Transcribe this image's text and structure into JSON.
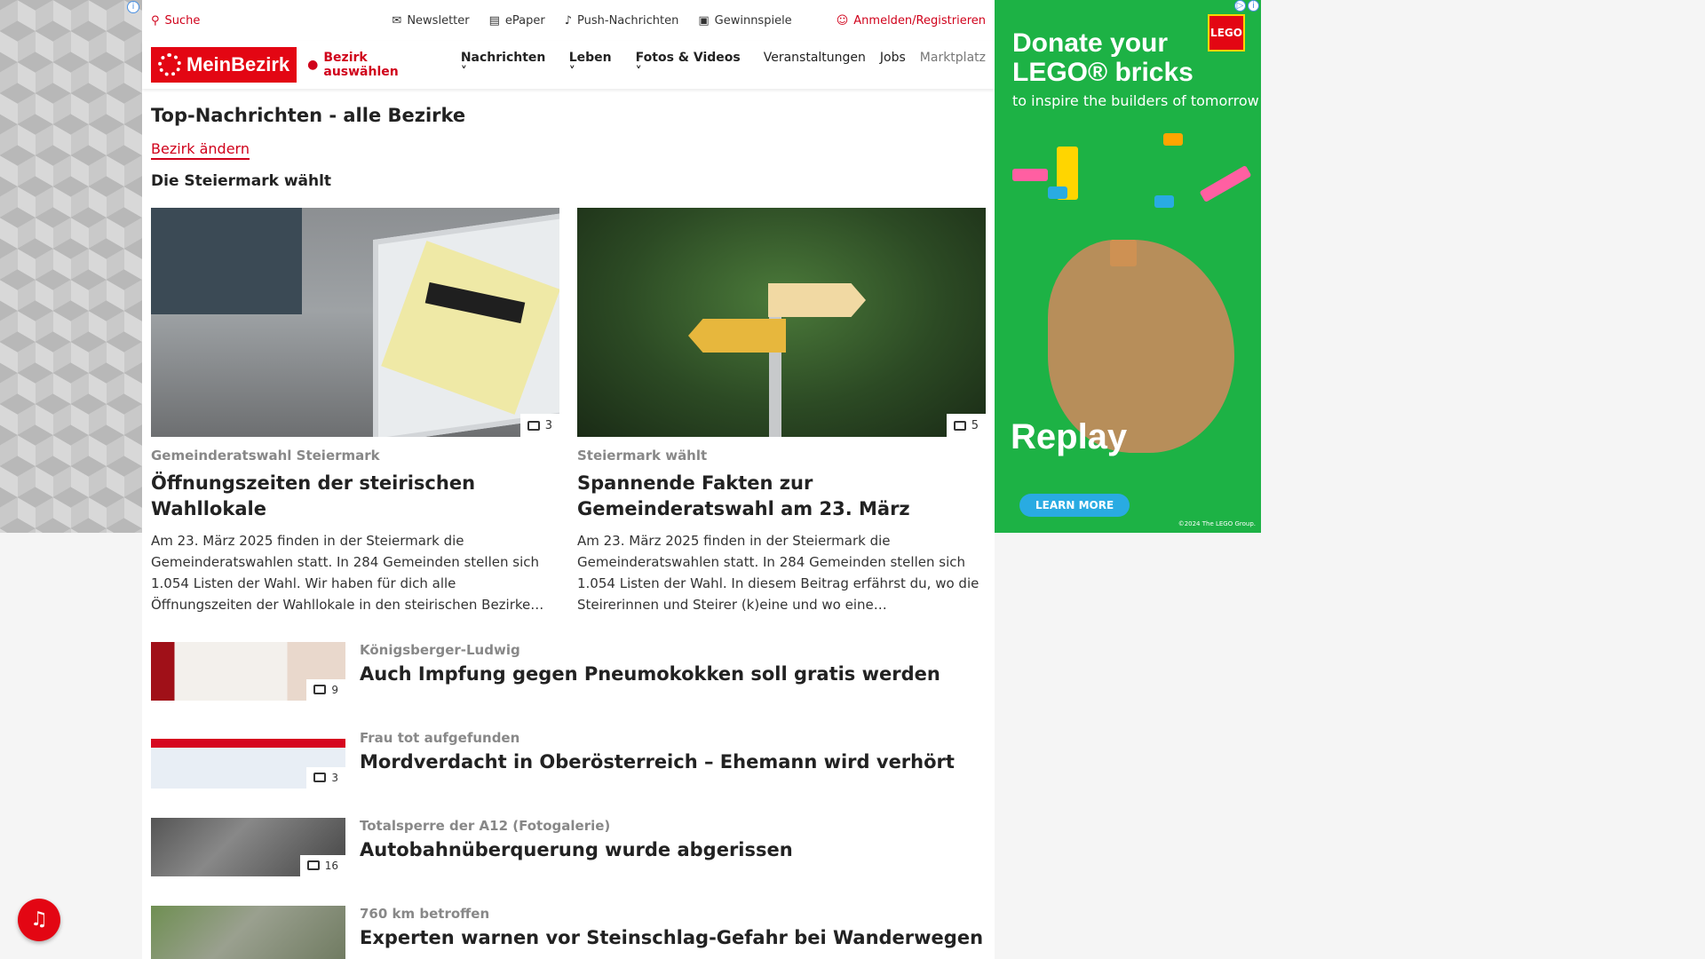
{
  "topbar": {
    "search": "Suche",
    "newsletter": "Newsletter",
    "epaper": "ePaper",
    "push": "Push-Nachrichten",
    "gewinnspiele": "Gewinnspiele",
    "login": "Anmelden/Registrieren"
  },
  "nav": {
    "logo": "MeinBezirk",
    "district": "Bezirk auswählen",
    "links": [
      "Nachrichten",
      "Leben",
      "Fotos & Videos",
      "Veranstaltungen",
      "Jobs",
      "Marktplatz"
    ]
  },
  "main": {
    "title": "Top-Nachrichten - alle Bezirke",
    "change_district": "Bezirk ändern",
    "section": "Die Steiermark wählt",
    "cards": [
      {
        "photo_count": "3",
        "kicker": "Gemeinderatswahl Steiermark",
        "title": "Öffnungszeiten der steirischen Wahllokale",
        "teaser": "Am 23. März 2025 finden in der Steiermark die Gemeinderatswahlen statt. In 284 Gemeinden stellen sich 1.054 Listen der Wahl. Wir haben für dich alle Öffnungszeiten der Wahllokale in den steirischen Bezirke…"
      },
      {
        "photo_count": "5",
        "kicker": "Steiermark wählt",
        "title": "Spannende Fakten zur Gemeinderatswahl am 23. März",
        "teaser": "Am 23. März 2025 finden in der Steiermark die Gemeinderatswahlen statt. In 284 Gemeinden stellen sich 1.054 Listen der Wahl. In diesem Beitrag erfährst du, wo die Steirerinnen und Steirer (k)eine und wo eine…"
      }
    ],
    "list": [
      {
        "photo_count": "9",
        "kicker": "Königsberger-Ludwig",
        "title": "Auch Impfung gegen Pneumokokken soll gratis werden"
      },
      {
        "photo_count": "3",
        "kicker": "Frau tot aufgefunden",
        "title": "Mordverdacht in Oberösterreich – Ehemann wird verhört"
      },
      {
        "photo_count": "16",
        "kicker": "Totalsperre der A12 (Fotogalerie)",
        "title": "Autobahnüberquerung wurde abgerissen"
      },
      {
        "photo_count": "",
        "kicker": "760 km betroffen",
        "title": "Experten warnen vor Steinschlag-Gefahr bei Wanderwegen"
      }
    ]
  },
  "ad": {
    "headline": "Donate your LEGO® bricks",
    "sub": "to inspire the builders of tomorrow",
    "brand": "LEGO",
    "replay": "Replay",
    "button": "LEARN MORE",
    "copyright": "©2024 The LEGO Group."
  }
}
